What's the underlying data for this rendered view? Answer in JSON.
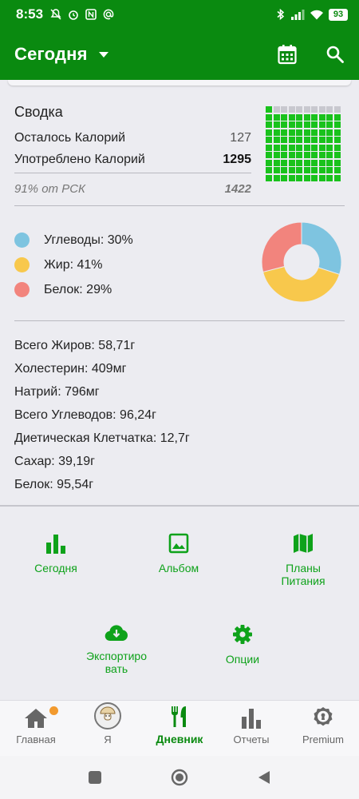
{
  "status": {
    "time": "8:53",
    "battery": "93"
  },
  "appbar": {
    "title": "Сегодня"
  },
  "summary": {
    "title": "Сводка",
    "remaining_label": "Осталось Калорий",
    "remaining_value": "127",
    "consumed_label": "Употреблено Калорий",
    "consumed_value": "1295",
    "rsk_label": "91% от РСК",
    "rsk_value": "1422",
    "consumed_fraction": 0.91
  },
  "macros": [
    {
      "label": "Углеводы: 30%",
      "percent": 30,
      "color": "#7ec4e0"
    },
    {
      "label": "Жир: 41%",
      "percent": 41,
      "color": "#f8c84c"
    },
    {
      "label": "Белок: 29%",
      "percent": 29,
      "color": "#f2847d"
    }
  ],
  "nutrients": [
    "Всего Жиров: 58,71г",
    "Холестерин: 409мг",
    "Натрий: 796мг",
    "Всего Углеводов: 96,24г",
    "Диетическая Клетчатка: 12,7г",
    "Сахар: 39,19г",
    "Белок: 95,54г"
  ],
  "actions": {
    "today": "Сегодня",
    "album": "Альбом",
    "plans": "Планы\nПитания",
    "export": "Экспортиро\nвать",
    "options": "Опции"
  },
  "bottom_nav": {
    "home": "Главная",
    "me": "Я",
    "diary": "Дневник",
    "reports": "Отчеты",
    "premium": "Premium"
  },
  "colors": {
    "brand": "#0a8a10",
    "accent": "#0ea21a",
    "waffle_on": "#19c21c",
    "waffle_off": "#c8c8cf"
  }
}
